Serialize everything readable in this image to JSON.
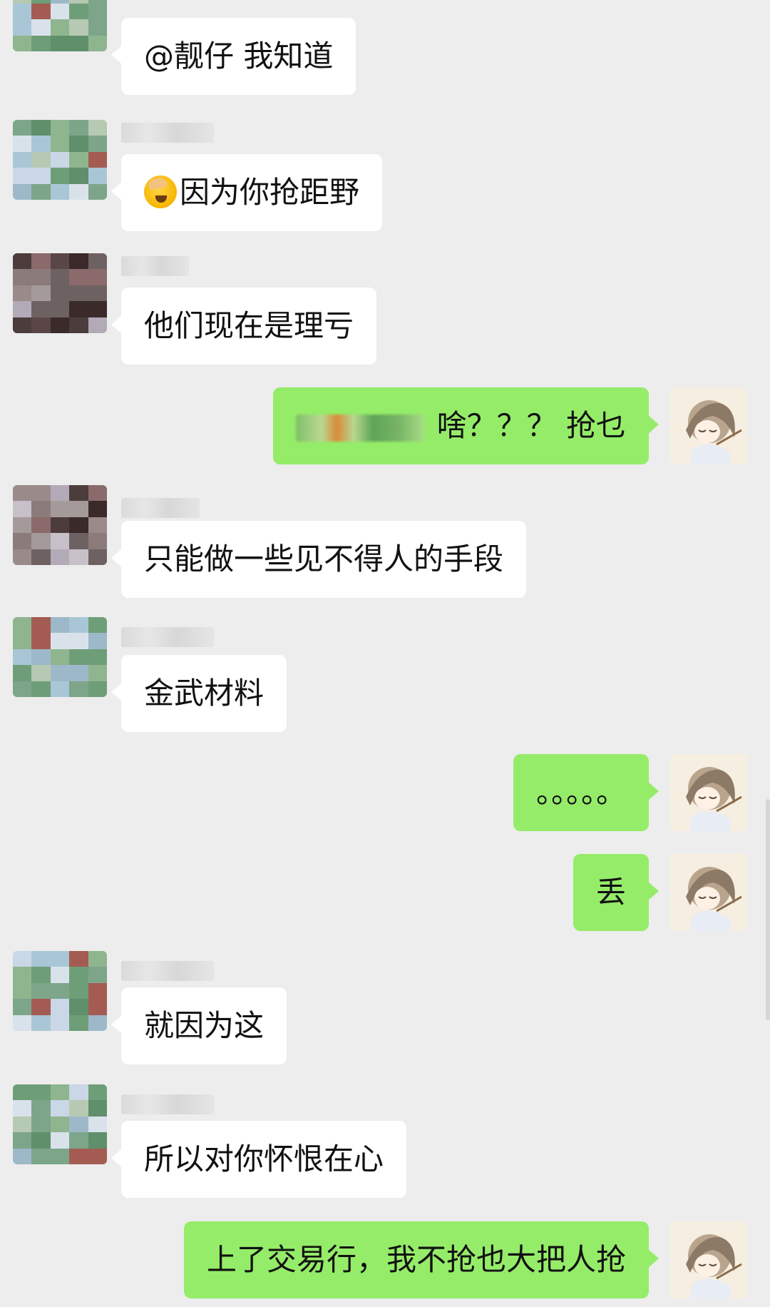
{
  "chat": {
    "messages": [
      {
        "side": "left",
        "text": "@靓仔  我知道"
      },
      {
        "side": "left",
        "emoji": "face-with-hand-over-eyes-emoji",
        "text": "因为你抢距野"
      },
      {
        "side": "left",
        "text": "他们现在是理亏"
      },
      {
        "side": "right",
        "text": "啥？？？ 抢乜"
      },
      {
        "side": "left",
        "text": "只能做一些见不得人的手段"
      },
      {
        "side": "left",
        "text": "金武材料"
      },
      {
        "side": "right",
        "text": "。。。。。"
      },
      {
        "side": "right",
        "text": "丢"
      },
      {
        "side": "left",
        "text": "就因为这"
      },
      {
        "side": "left",
        "text": "所以对你怀恨在心"
      },
      {
        "side": "right",
        "text": "上了交易行，我不抢也大把人抢"
      }
    ]
  },
  "colors": {
    "background": "#ededed",
    "incoming_bubble": "#ffffff",
    "outgoing_bubble": "#95ec69"
  }
}
